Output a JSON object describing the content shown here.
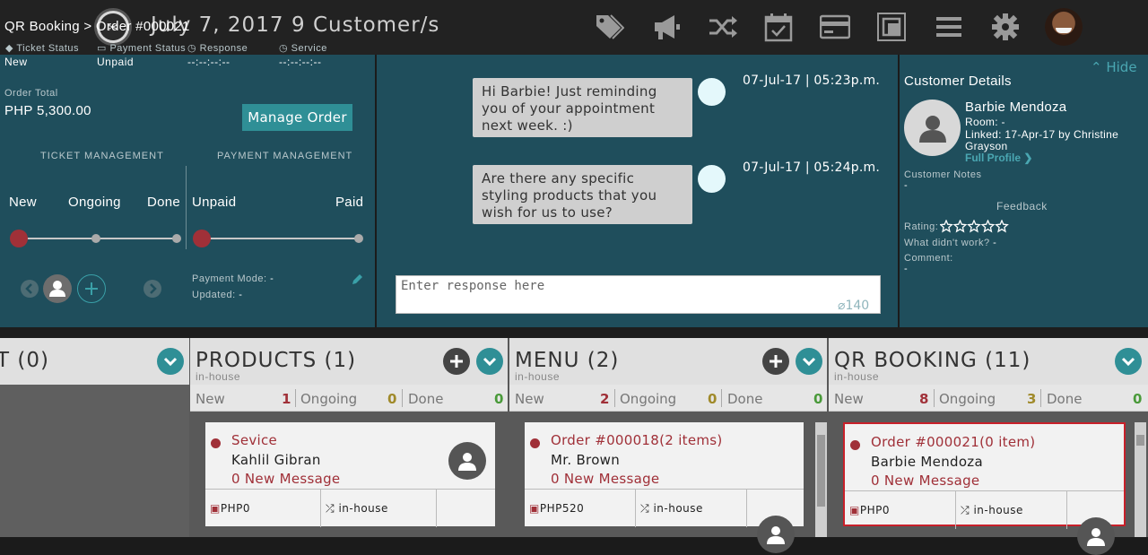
{
  "topbar": {
    "date": "July 7, 2017",
    "customers": "9 Customer/s",
    "logo_icon": "scissors-icon",
    "icons": [
      "tag-icon",
      "megaphone-icon",
      "shuffle-icon",
      "calendar-check-icon",
      "credit-card-icon",
      "resize-icon",
      "menu-icon",
      "gear-icon"
    ]
  },
  "order": {
    "breadcrumb": "QR Booking > Order #000021",
    "stats": [
      {
        "label": "Ticket Status",
        "value": "New",
        "icon": "tag-icon"
      },
      {
        "label": "Payment Status",
        "value": "Unpaid",
        "icon": "money-icon"
      },
      {
        "label": "Response",
        "value": "--:--:--:--",
        "icon": "clock-icon"
      },
      {
        "label": "Service",
        "value": "--:--:--:--",
        "icon": "clock-icon"
      }
    ],
    "total_label": "Order Total",
    "total_value": "PHP 5,300.00",
    "manage_label": "Manage Order",
    "ticket_mgmt_title": "TICKET MANAGEMENT",
    "payment_mgmt_title": "PAYMENT MANAGEMENT",
    "ticket_stages": [
      "New",
      "Ongoing",
      "Done"
    ],
    "payment_stages": [
      "Unpaid",
      "Paid"
    ],
    "payment_mode_label": "Payment Mode:",
    "payment_mode_value": "-",
    "updated_label": "Updated:",
    "updated_value": "-"
  },
  "chat": {
    "messages": [
      {
        "text": "Hi Barbie! Just reminding you of your appointment next week. :)",
        "time": "07-Jul-17 | 05:23p.m."
      },
      {
        "text": "Are there any specific styling products that you wish for us to use?",
        "time": "07-Jul-17 | 05:24p.m."
      }
    ],
    "placeholder": "Enter response here",
    "char_count": "140"
  },
  "customer": {
    "hide_label": "Hide",
    "title": "Customer Details",
    "name": "Barbie Mendoza",
    "room": "Room: -",
    "linked_1": "Linked: 17-Apr-17 by Christine",
    "linked_2": "Grayson",
    "full_profile": "Full Profile",
    "notes_label": "Customer Notes",
    "notes_value": "-",
    "feedback_label": "Feedback",
    "rating_label": "Rating:",
    "rating_value": 0,
    "rating_max": 5,
    "didnt_work_label": "What didn't work?",
    "didnt_work_value": "-",
    "comment_label": "Comment:",
    "comment_value": "-"
  },
  "columns": [
    {
      "title": "T (0)",
      "sub": "",
      "has_plus": false,
      "counts": []
    },
    {
      "title": "PRODUCTS (1)",
      "sub": "in-house",
      "has_plus": true,
      "status": [
        {
          "label": "New",
          "count": "1"
        },
        {
          "label": "Ongoing",
          "count": "0"
        },
        {
          "label": "Done",
          "count": "0"
        }
      ],
      "card": {
        "title": "Sevice",
        "name": "Kahlil Gibran",
        "message": "0 New Message",
        "price": "PHP0",
        "type": "in-house"
      }
    },
    {
      "title": "MENU (2)",
      "sub": "in-house",
      "has_plus": true,
      "status": [
        {
          "label": "New",
          "count": "2"
        },
        {
          "label": "Ongoing",
          "count": "0"
        },
        {
          "label": "Done",
          "count": "0"
        }
      ],
      "card": {
        "title": "Order #000018(2 items)",
        "name": "Mr. Brown",
        "message": "0 New Message",
        "price": "PHP520",
        "type": "in-house"
      }
    },
    {
      "title": "QR BOOKING (11)",
      "sub": "in-house",
      "has_plus": false,
      "status": [
        {
          "label": "New",
          "count": "8"
        },
        {
          "label": "Ongoing",
          "count": "3"
        },
        {
          "label": "Done",
          "count": "0"
        }
      ],
      "card": {
        "title": "Order #000021(0 item)",
        "name": "Barbie Mendoza",
        "message": "0 New Message",
        "price": "PHP0",
        "type": "in-house"
      }
    }
  ],
  "colors": {
    "accent": "#2f8f96",
    "panel": "#1f4e5c",
    "alert": "#a03038",
    "count_new": "#a03038",
    "count_ongoing": "#a08a2a",
    "count_done": "#4a9a3a"
  }
}
